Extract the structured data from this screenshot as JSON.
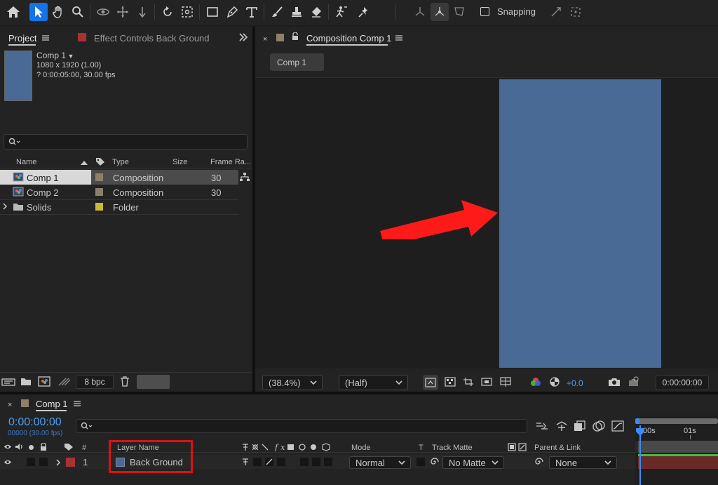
{
  "toolbar": {
    "tools": [
      "home-icon",
      "selection-tool-icon",
      "hand-tool-icon",
      "zoom-tool-icon",
      "orbit-camera-icon",
      "pan-camera-icon",
      "dolly-camera-icon",
      "rotation-tool-icon",
      "pan-behind-icon",
      "rectangle-tool-icon",
      "pen-tool-icon",
      "type-tool-icon",
      "brush-tool-icon",
      "clone-stamp-icon",
      "eraser-tool-icon",
      "roto-brush-icon",
      "puppet-pin-icon"
    ],
    "snapping_label": "Snapping",
    "snapping_checked": false
  },
  "project_panel": {
    "tab_project": "Project",
    "tab_effect_controls": "Effect Controls Back Ground",
    "comp_name": "Comp 1",
    "comp_resolution": "1080 x 1920 (1.00)",
    "comp_duration": "? 0:00:05:00, 30.00 fps",
    "search_placeholder": "",
    "columns": {
      "name": "Name",
      "type": "Type",
      "size": "Size",
      "frame_rate": "Frame Ra..."
    },
    "items": [
      {
        "name": "Comp 1",
        "type": "Composition",
        "size": "",
        "frame_rate": "30",
        "label_color": "#8e7f6a",
        "selected": true
      },
      {
        "name": "Comp 2",
        "type": "Composition",
        "size": "",
        "frame_rate": "30",
        "label_color": "#8e7f6a",
        "selected": false
      },
      {
        "name": "Solids",
        "type": "Folder",
        "size": "",
        "frame_rate": "",
        "label_color": "#c8b832",
        "selected": false
      }
    ],
    "bpc_label": "8 bpc"
  },
  "composition_panel": {
    "tab_title": "Composition Comp 1",
    "comp_tab": "Comp 1",
    "background_color": "#4a6a96",
    "zoom": "(38.4%)",
    "resolution": "(Half)",
    "exposure": "+0.0",
    "timecode": "0:00:00:00"
  },
  "timeline_panel": {
    "tab_title": "Comp 1",
    "current_time": "0:00:00:00",
    "frame_info": "00000 (30.00 fps)",
    "search_placeholder": "",
    "columns": {
      "num": "#",
      "layer_name": "Layer Name",
      "mode": "Mode",
      "t": "T",
      "track_matte": "Track Matte",
      "parent_link": "Parent & Link"
    },
    "layers": [
      {
        "num": "1",
        "name": "Back Ground",
        "label_color": "#a83232",
        "mode": "Normal",
        "track_matte": "No Matte",
        "parent": "None",
        "color": "#4a6a96"
      }
    ],
    "ruler": {
      "t0": "00s",
      "t1": "01s"
    }
  },
  "annotations": {
    "arrow_color": "#ff1a1a",
    "highlight_color": "#e01010"
  }
}
